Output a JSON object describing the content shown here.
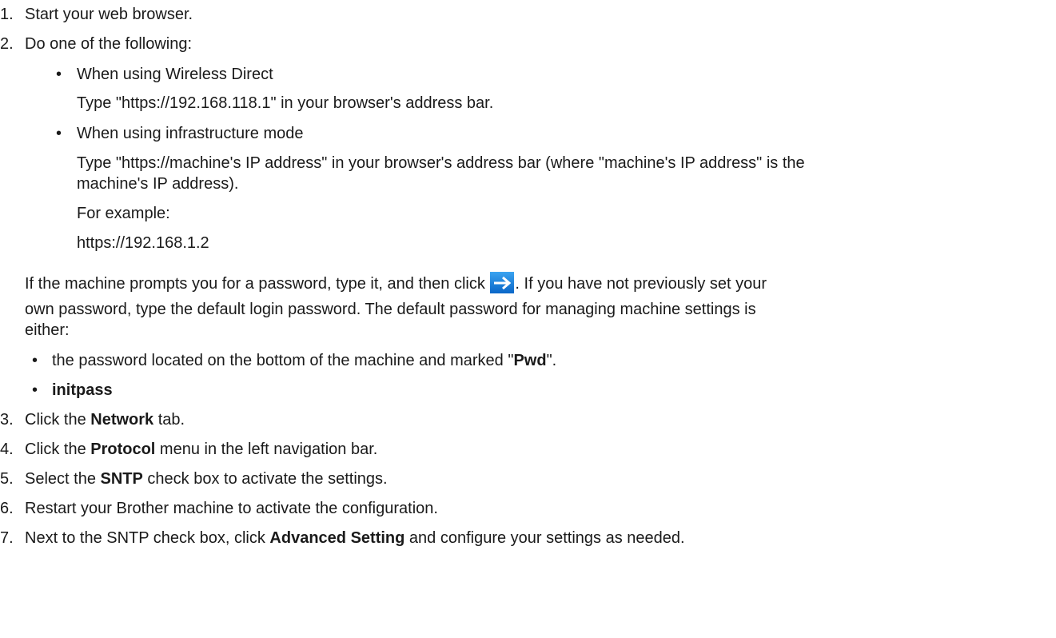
{
  "steps": {
    "s1": {
      "num": "1.",
      "text": "Start your web browser."
    },
    "s2": {
      "num": "2.",
      "text": "Do one of the following:"
    },
    "s2a": {
      "bullet": "•",
      "title": "When using Wireless Direct",
      "detail": "Type \"https://192.168.118.1\" in your browser's address bar."
    },
    "s2b": {
      "bullet": "•",
      "title": "When using infrastructure mode",
      "detail_1": "Type \"https://machine's IP address\" in your browser's address bar (where \"machine's IP address\" is the",
      "detail_2": "machine's IP address).",
      "example_label": "For example:",
      "example_value": "https://192.168.1.2"
    },
    "note": {
      "part1": "If the machine prompts you for a password, type it, and then click ",
      "part2": ". If you have not previously set your",
      "line2": "own password, type the default login password. The default password for managing machine settings is",
      "line3": "either:",
      "bullet1_pre": "the password located on the bottom of the machine and marked \"",
      "bullet1_bold": "Pwd",
      "bullet1_post": "\".",
      "bullet2_bold": "initpass"
    },
    "s3": {
      "num": "3.",
      "pre": "Click the ",
      "bold": "Network",
      "post": " tab."
    },
    "s4": {
      "num": "4.",
      "pre": "Click the ",
      "bold": "Protocol",
      "post": " menu in the left navigation bar."
    },
    "s5": {
      "num": "5.",
      "pre": "Select the ",
      "bold": "SNTP",
      "post": " check box to activate the settings."
    },
    "s6": {
      "num": "6.",
      "text": "Restart your Brother machine to activate the configuration."
    },
    "s7": {
      "num": "7.",
      "pre": "Next to the SNTP check box, click ",
      "bold": "Advanced Setting",
      "post": " and configure your settings as needed."
    }
  },
  "icons": {
    "submit_arrow": "arrow-right-icon"
  }
}
